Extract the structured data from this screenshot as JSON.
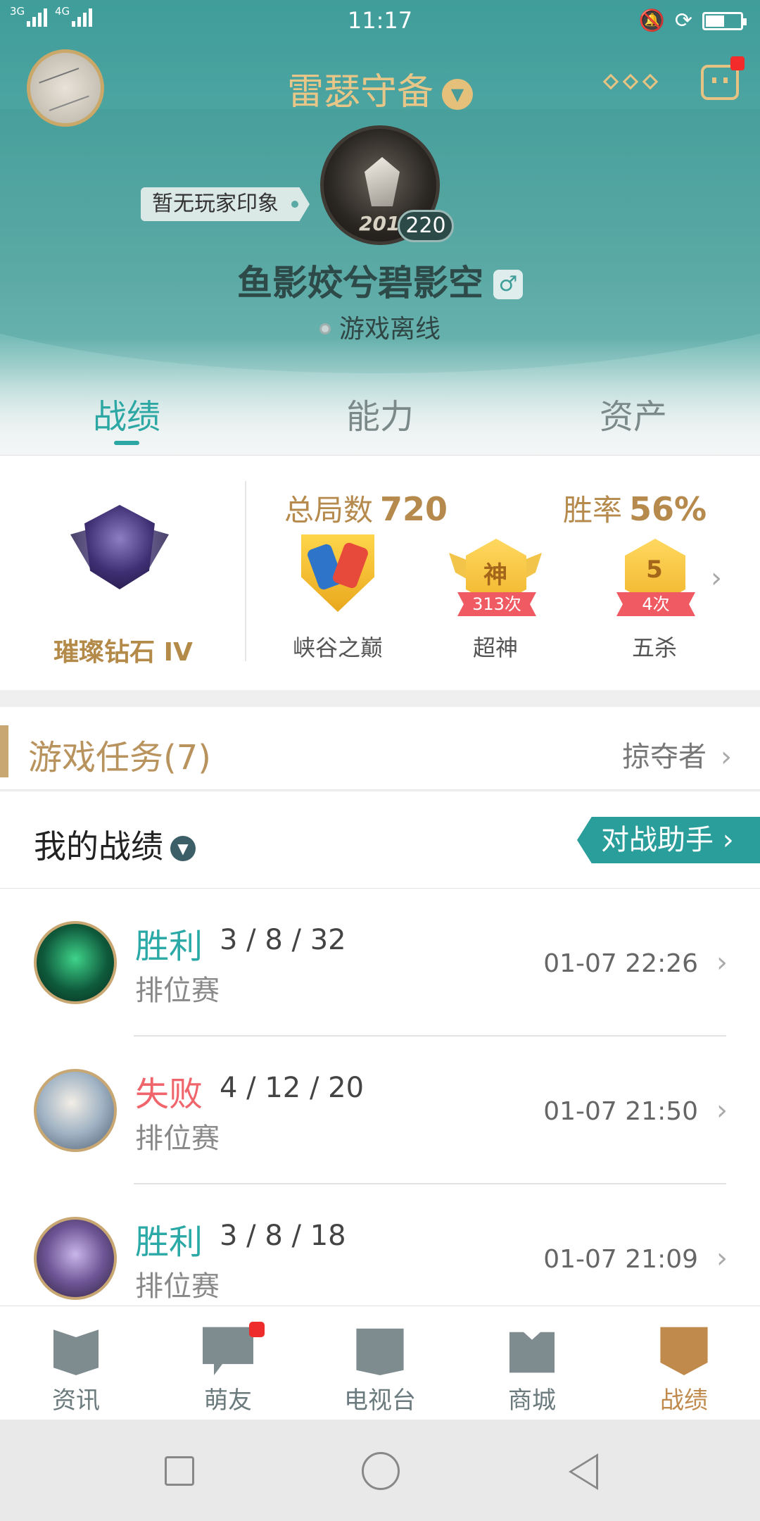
{
  "status_bar": {
    "signal_left": "3G",
    "signal_right": "4G",
    "time": "11:17"
  },
  "header": {
    "server_name": "雷瑟守备",
    "impression_tag": "暂无玩家印象",
    "emblem_year": "2014",
    "level": "220",
    "nickname": "鱼影姣兮碧影空",
    "gender_symbol": "♂",
    "online_status": "游戏离线"
  },
  "tabs": [
    {
      "label": "战绩",
      "active": true
    },
    {
      "label": "能力",
      "active": false
    },
    {
      "label": "资产",
      "active": false
    }
  ],
  "stats": {
    "rank_name": "璀璨钻石 IV",
    "total_games_label": "总局数",
    "total_games_value": "720",
    "win_rate_label": "胜率",
    "win_rate_value": "56%",
    "badges": [
      {
        "label": "峡谷之巅",
        "icon": "peak-badge-icon"
      },
      {
        "label": "超神",
        "icon_text": "神",
        "count": "313次"
      },
      {
        "label": "五杀",
        "icon_text": "5",
        "count": "4次"
      }
    ]
  },
  "tasks": {
    "title": "游戏任务(7)",
    "right_label": "掠夺者"
  },
  "my_records": {
    "title": "我的战绩",
    "assistant_button": "对战助手 ›"
  },
  "records": [
    {
      "result": "胜利",
      "kda": "3 / 8 / 32",
      "mode": "排位赛",
      "time": "01-07 22:26",
      "outcome": "win"
    },
    {
      "result": "失败",
      "kda": "4 / 12 / 20",
      "mode": "排位赛",
      "time": "01-07 21:50",
      "outcome": "lose"
    },
    {
      "result": "胜利",
      "kda": "3 / 8 / 18",
      "mode": "排位赛",
      "time": "01-07 21:09",
      "outcome": "win"
    }
  ],
  "bottom_nav": [
    {
      "label": "资讯",
      "active": false
    },
    {
      "label": "萌友",
      "active": false,
      "badge": true
    },
    {
      "label": "电视台",
      "active": false
    },
    {
      "label": "商城",
      "active": false
    },
    {
      "label": "战绩",
      "active": true
    }
  ],
  "colors": {
    "accent_teal": "#2ba9a6",
    "accent_gold": "#c08a4c",
    "lose_red": "#f0646b"
  }
}
